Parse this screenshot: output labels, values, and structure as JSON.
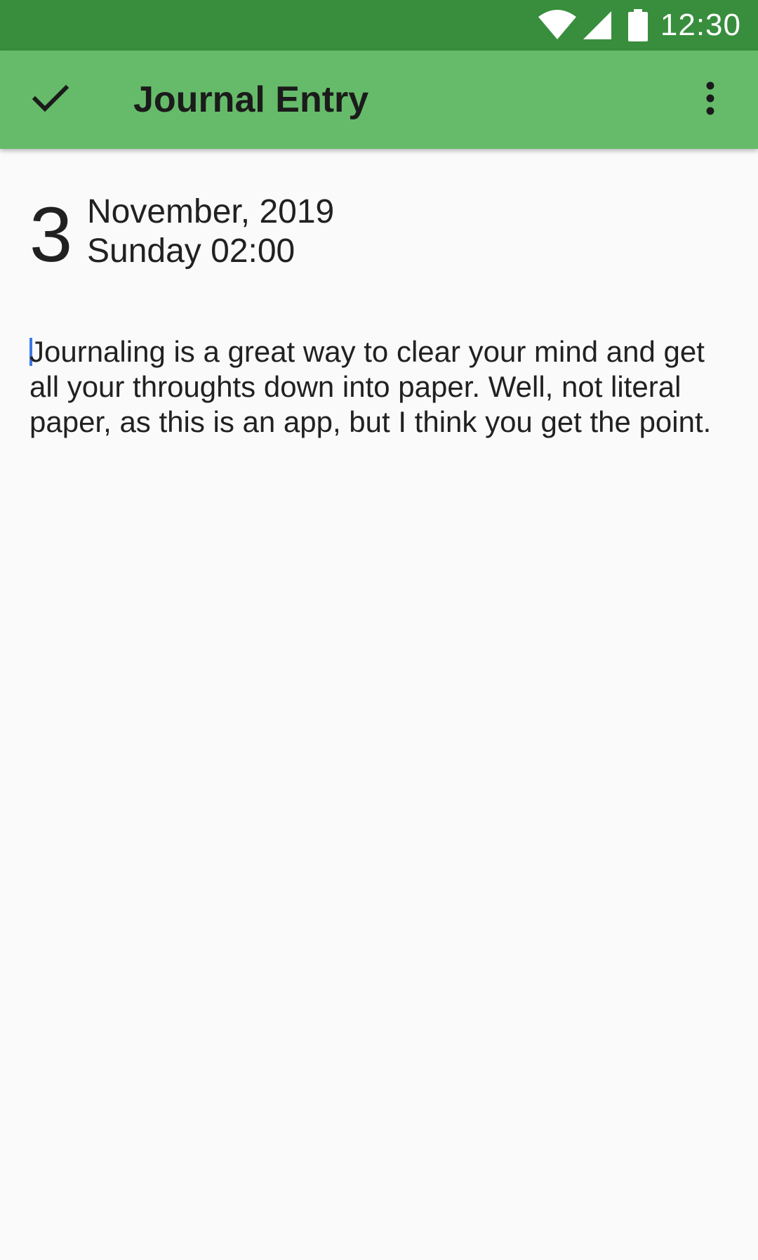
{
  "status_bar": {
    "time": "12:30",
    "icons": [
      "wifi-icon",
      "cell-signal-icon",
      "battery-icon"
    ],
    "background": "#388e3c"
  },
  "app_bar": {
    "title": "Journal Entry",
    "background": "#66bb6a",
    "leading_icon": "check-icon",
    "trailing_icon": "more-vert-icon"
  },
  "entry": {
    "day": "3",
    "month_year": "November, 2019",
    "weekday_time": "Sunday 02:00",
    "body": "Journaling is a great way to clear your mind and get all your throughts down into paper. Well, not literal paper, as this is an app, but I think you get the point."
  },
  "colors": {
    "cursor": "#3b78e7",
    "text": "#212121",
    "page_background": "#fafafa"
  }
}
